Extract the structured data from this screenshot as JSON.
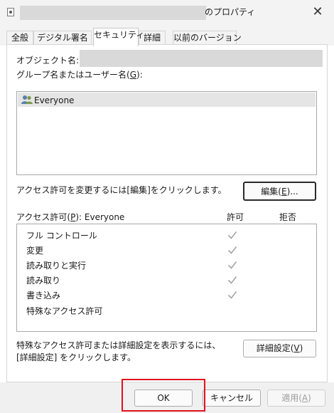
{
  "window": {
    "title_suffix": "のプロパティ",
    "close_symbol": "✕"
  },
  "tabs": [
    {
      "label": "全般"
    },
    {
      "label": "デジタル署名"
    },
    {
      "label": "セキュリティ"
    },
    {
      "label": "詳細"
    },
    {
      "label": "以前のバージョン"
    }
  ],
  "security": {
    "object_name_label": "オブジェクト名:",
    "group_label_prefix": "グループ名またはユーザー名(",
    "group_label_key": "G",
    "group_label_suffix": "):",
    "groups": [
      {
        "name": "Everyone",
        "icon": "users-icon"
      }
    ],
    "change_perm_text": "アクセス許可を変更するには[編集]をクリックします。",
    "edit_button": {
      "prefix": "編集(",
      "key": "E",
      "suffix": ")..."
    },
    "perm_label_prefix": "アクセス許可(",
    "perm_label_key": "P",
    "perm_label_suffix": "): Everyone",
    "allow_header": "許可",
    "deny_header": "拒否",
    "permissions": [
      {
        "label": "フル コントロール",
        "allow": true,
        "deny": false
      },
      {
        "label": "変更",
        "allow": true,
        "deny": false
      },
      {
        "label": "読み取りと実行",
        "allow": true,
        "deny": false
      },
      {
        "label": "読み取り",
        "allow": true,
        "deny": false
      },
      {
        "label": "書き込み",
        "allow": true,
        "deny": false
      },
      {
        "label": "特殊なアクセス許可",
        "allow": false,
        "deny": false
      }
    ],
    "advanced_text": "特殊なアクセス許可または詳細設定を表示するには、[詳細設定] をクリックします。",
    "advanced_button": {
      "prefix": "詳細設定(",
      "key": "V",
      "suffix": ")"
    }
  },
  "footer": {
    "ok_label": "OK",
    "cancel_label": "キャンセル",
    "apply": {
      "prefix": "適用(",
      "key": "A",
      "suffix": ")"
    }
  },
  "colors": {
    "highlight": "#e0121e",
    "check_disabled": "#a6a6a6"
  }
}
